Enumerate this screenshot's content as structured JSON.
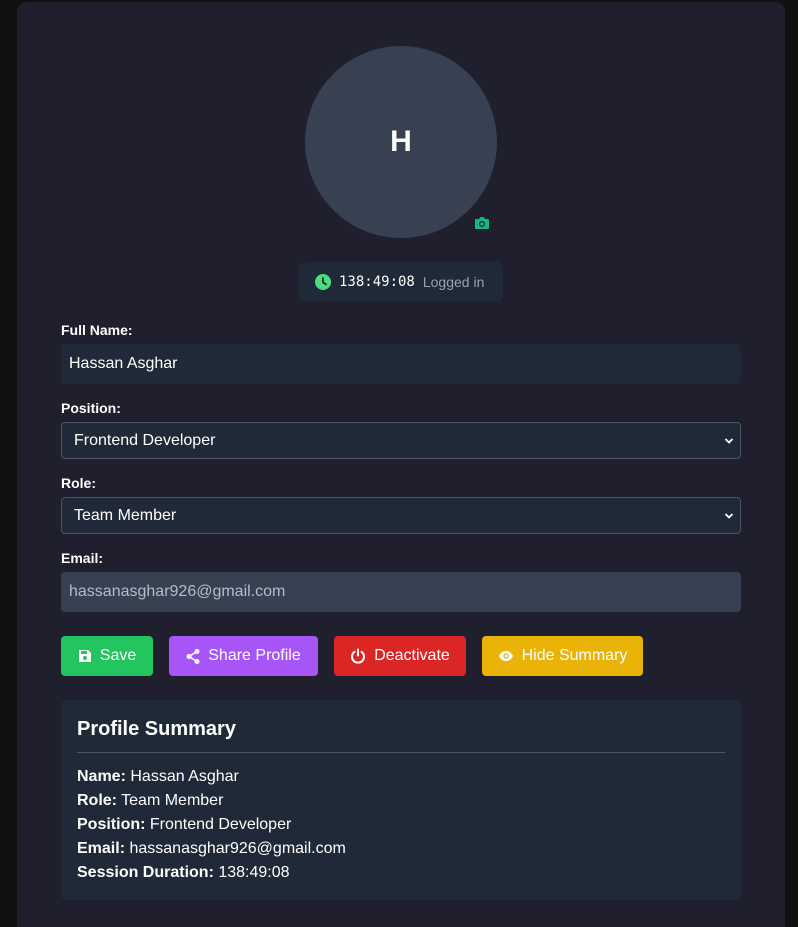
{
  "avatar": {
    "initial": "H",
    "camera_icon": "camera-icon"
  },
  "session": {
    "timer": "138:49:08",
    "status": "Logged in",
    "icon": "clock-icon",
    "icon_color": "#4ade80"
  },
  "form": {
    "full_name": {
      "label": "Full Name:",
      "value": "Hassan Asghar"
    },
    "position": {
      "label": "Position:",
      "value": "Frontend Developer"
    },
    "role": {
      "label": "Role:",
      "value": "Team Member"
    },
    "email": {
      "label": "Email:",
      "value": "hassanasghar926@gmail.com"
    }
  },
  "buttons": {
    "save": {
      "label": "Save",
      "icon": "floppy-disk-icon",
      "color": "#22c55e"
    },
    "share": {
      "label": "Share Profile",
      "icon": "share-icon",
      "color": "#a855f7"
    },
    "deactivate": {
      "label": "Deactivate",
      "icon": "power-icon",
      "color": "#dc2626"
    },
    "hide_summary": {
      "label": "Hide Summary",
      "icon": "eye-icon",
      "color": "#eab308"
    }
  },
  "summary": {
    "title": "Profile Summary",
    "name_key": "Name:",
    "name_val": "Hassan Asghar",
    "role_key": "Role:",
    "role_val": "Team Member",
    "position_key": "Position:",
    "position_val": "Frontend Developer",
    "email_key": "Email:",
    "email_val": "hassanasghar926@gmail.com",
    "duration_key": "Session Duration:",
    "duration_val": "138:49:08"
  }
}
